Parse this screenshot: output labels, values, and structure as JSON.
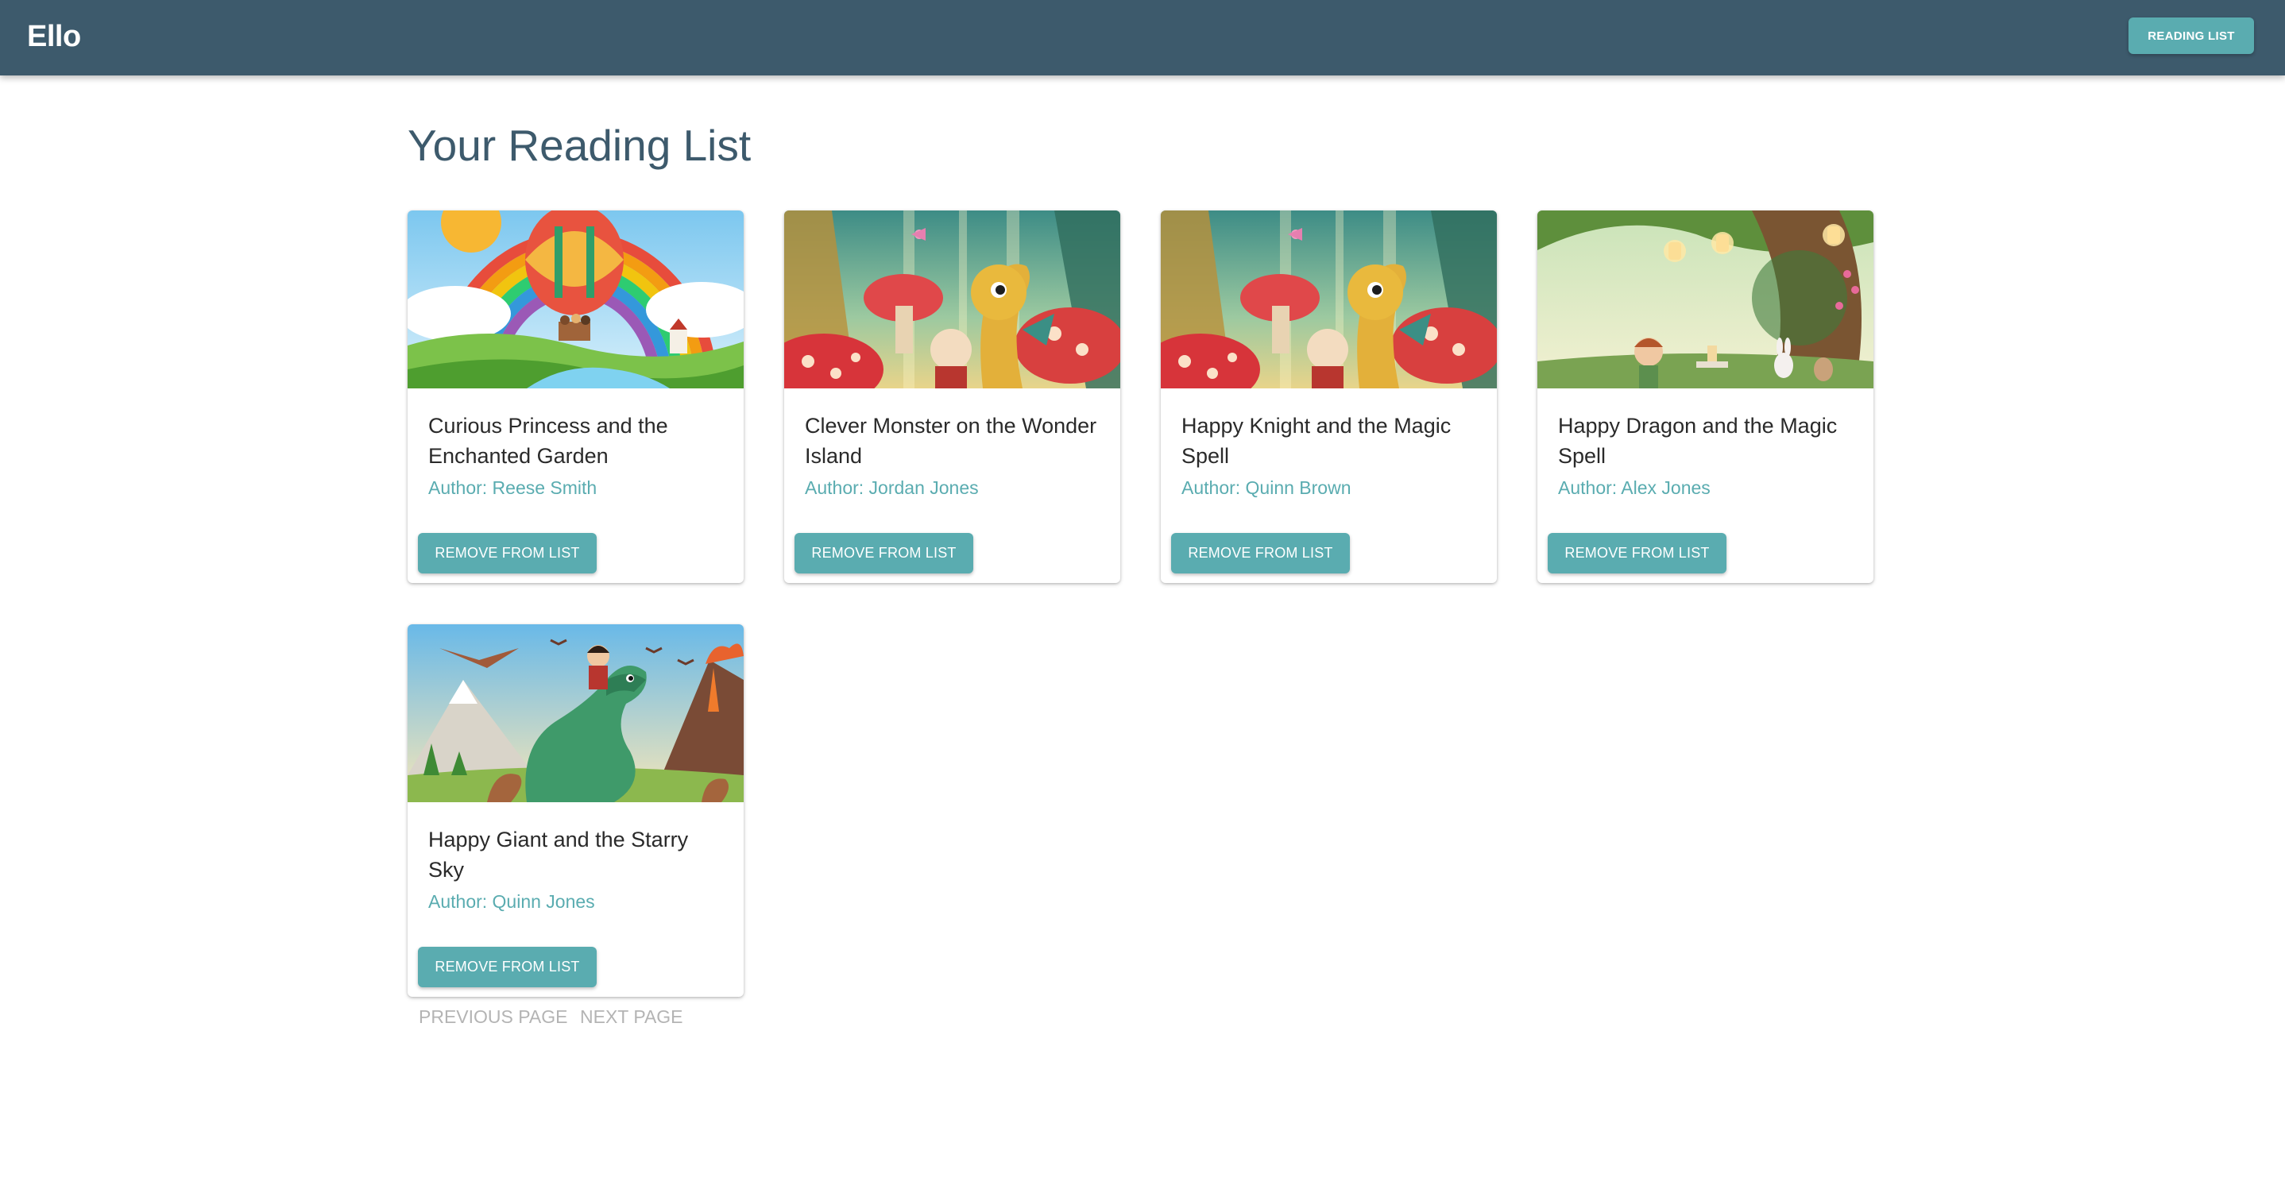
{
  "header": {
    "brand": "Ello",
    "reading_list_button": "READING LIST"
  },
  "page": {
    "title": "Your Reading List"
  },
  "books": [
    {
      "title": "Curious Princess and the Enchanted Garden",
      "author": "Author: Reese Smith",
      "action": "REMOVE FROM LIST",
      "image": "rainbow-balloon-illustration"
    },
    {
      "title": "Clever Monster on the Wonder Island",
      "author": "Author: Jordan Jones",
      "action": "REMOVE FROM LIST",
      "image": "dragon-mushroom-forest-illustration"
    },
    {
      "title": "Happy Knight and the Magic Spell",
      "author": "Author: Quinn Brown",
      "action": "REMOVE FROM LIST",
      "image": "dragon-mushroom-forest-illustration"
    },
    {
      "title": "Happy Dragon and the Magic Spell",
      "author": "Author: Alex Jones",
      "action": "REMOVE FROM LIST",
      "image": "fairy-tea-party-forest-illustration"
    },
    {
      "title": "Happy Giant and the Starry Sky",
      "author": "Author: Quinn Jones",
      "action": "REMOVE FROM LIST",
      "image": "dinosaur-volcano-illustration"
    }
  ],
  "pagination": {
    "previous": "PREVIOUS PAGE",
    "next": "NEXT PAGE"
  },
  "colors": {
    "appbar": "#3d5a6c",
    "accent": "#5aacb0",
    "title": "#3d5a6c",
    "pager_disabled": "#b4b4b4"
  }
}
